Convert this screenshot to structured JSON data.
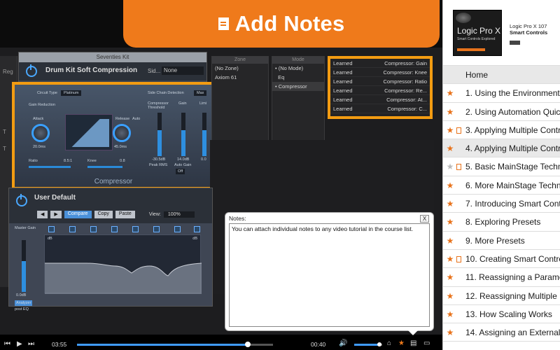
{
  "banner": {
    "title": "Add Notes",
    "icon": "note-icon"
  },
  "plugin": {
    "window_title": "Seventies Kit",
    "preset": "Drum Kit Soft Compression",
    "sidechain_label": "Sid...",
    "sidechain_value": "None",
    "circuit_type_label": "Circuit Type",
    "circuit_type": "Platinum",
    "sidechain_detection_label": "Side Chain Detection",
    "sidechain_detection": "Max",
    "gain_reduction_label": "Gain Reduction",
    "attack_label": "Attack",
    "attack_value": "20.0ms",
    "release_label": "Release",
    "release_value": "45.0ms",
    "auto_label": "Auto",
    "compressor_threshold_label": "Compressor Threshold",
    "gain_label": "Gain",
    "limiter_label": "Limi",
    "threshold_value": "-30.5dB",
    "gain_value": "14.0dB",
    "limiter_value": "0.0",
    "ratio_label": "Ratio",
    "ratio_value": "8.5:1",
    "knee_label": "Knee",
    "knee_value": "0.8",
    "peak_rms_label": "Peak  RMS",
    "auto_gain_label": "Auto Gain",
    "auto_gain_value": "Off",
    "footer_label": "Compressor",
    "compare_label": "Compare",
    "copy_label": "Copy",
    "paste_label": "Paste",
    "zoom_value": "100%"
  },
  "columns": {
    "zone_header": "Zone",
    "mode_header": "Mode",
    "zones": [
      "(No Zone)",
      "Axiom 61"
    ],
    "modes": [
      "(No Mode)",
      "Eq",
      "Compressor"
    ]
  },
  "mappings": [
    {
      "state": "Learned",
      "param": "Compressor: Gain"
    },
    {
      "state": "Learned",
      "param": "Compressor: Knee"
    },
    {
      "state": "Learned",
      "param": "Compressor: Ratio"
    },
    {
      "state": "Learned",
      "param": "Compressor: Re..."
    },
    {
      "state": "Learned",
      "param": "Compressor: At..."
    },
    {
      "state": "Learned",
      "param": "Compressor: C..."
    }
  ],
  "eq": {
    "preset": "User Default",
    "compare_label": "Compare",
    "copy_label": "Copy",
    "paste_label": "Paste",
    "view_label": "View:",
    "view_value": "100%",
    "master_gain_label": "Master Gain",
    "gain_value": "0.0dB",
    "analyzer_label": "Analyzer",
    "post_label": "post EQ",
    "db_label": "dB"
  },
  "notes": {
    "title": "Notes:",
    "close_label": "X",
    "text": "You can attach individual notes to any video tutorial in the course list."
  },
  "player": {
    "current_time": "03:55",
    "remaining_time": "00:40",
    "progress": 0.87,
    "volume": 0.9
  },
  "course": {
    "cover_title": "Logic Pro X",
    "cover_subtitle": "Smart Controls Explored",
    "title_line1": "Logic Pro X 107",
    "title_line2": "Smart Controls"
  },
  "menu": {
    "home_label": "Home",
    "items": [
      {
        "label": "1. Using the Environment",
        "starred": true,
        "note": false,
        "selected": false
      },
      {
        "label": "2. Using Automation Quick",
        "starred": true,
        "note": false,
        "selected": false
      },
      {
        "label": "3. Applying Multiple Contro",
        "starred": true,
        "note": true,
        "selected": false
      },
      {
        "label": "4. Applying Multiple Contro",
        "starred": true,
        "note": false,
        "selected": true
      },
      {
        "label": "5. Basic MainStage Techni",
        "starred": false,
        "note": true,
        "selected": false
      },
      {
        "label": "6. More MainStage Techni",
        "starred": true,
        "note": false,
        "selected": false
      },
      {
        "label": "7. Introducing Smart Contr",
        "starred": true,
        "note": false,
        "selected": false
      },
      {
        "label": "8. Exploring Presets",
        "starred": true,
        "note": false,
        "selected": false
      },
      {
        "label": "9. More Presets",
        "starred": true,
        "note": false,
        "selected": false
      },
      {
        "label": "10. Creating Smart Contro",
        "starred": true,
        "note": true,
        "selected": false
      },
      {
        "label": "11. Reassigning a Parame",
        "starred": true,
        "note": false,
        "selected": false
      },
      {
        "label": "12. Reassigning Multiple P",
        "starred": true,
        "note": false,
        "selected": false
      },
      {
        "label": "13. How Scaling Works",
        "starred": true,
        "note": false,
        "selected": false
      },
      {
        "label": "14. Assigning an External",
        "starred": true,
        "note": false,
        "selected": false
      }
    ]
  },
  "colors": {
    "accent": "#ef7a1b",
    "highlight": "#f39c12",
    "blue": "#3f9bff"
  },
  "left_labels": [
    "Reg",
    "T",
    "T"
  ]
}
